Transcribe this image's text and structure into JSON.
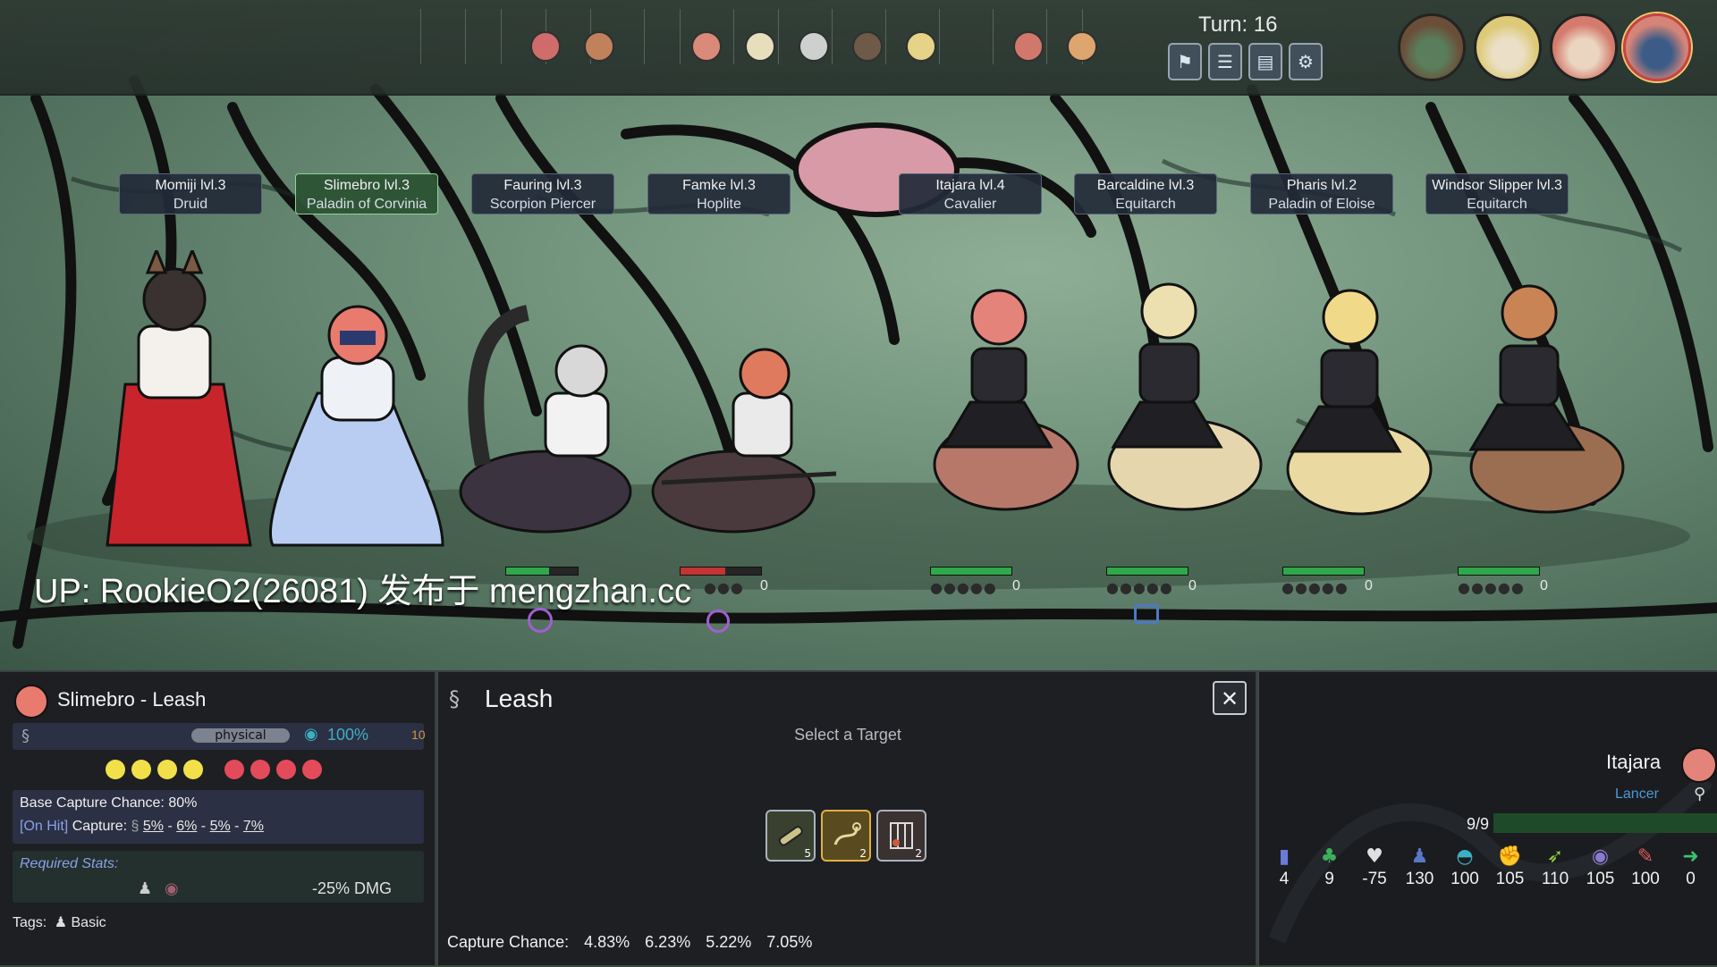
{
  "turn": "Turn: 16",
  "top_buttons": [
    {
      "icon": "flag-icon",
      "glyph": "⚑"
    },
    {
      "icon": "list-icon",
      "glyph": "☰"
    },
    {
      "icon": "book-icon",
      "glyph": "▤"
    },
    {
      "icon": "gear-icon",
      "glyph": "⚙"
    }
  ],
  "units": [
    {
      "name": "Momiji lvl.3",
      "cls": "Druid",
      "pips": ""
    },
    {
      "name": "Slimebro lvl.3",
      "cls": "Paladin of Corvinia",
      "pips": ""
    },
    {
      "name": "Fauring lvl.3",
      "cls": "Scorpion Piercer",
      "pips": ""
    },
    {
      "name": "Famke lvl.3",
      "cls": "Hoplite",
      "pips": "0"
    },
    {
      "name": "Itajara lvl.4",
      "cls": "Cavalier",
      "pips": "0"
    },
    {
      "name": "Barcaldine lvl.3",
      "cls": "Equitarch",
      "pips": "0"
    },
    {
      "name": "Pharis lvl.2",
      "cls": "Paladin of Eloise",
      "pips": "0"
    },
    {
      "name": "Windsor Slipper lvl.3",
      "cls": "Equitarch",
      "pips": "0"
    }
  ],
  "watermark": "UP: RookieO2(26081) 发布于 mengzhan.cc",
  "left_panel": {
    "title": "Slimebro - Leash",
    "damage_type": "physical",
    "accuracy": "100%",
    "crit": "10",
    "base_capture": "Base Capture Chance: 80%",
    "on_hit_tag": "[On Hit]",
    "capture_label": "Capture:",
    "capture_values": [
      "5%",
      "6%",
      "5%",
      "7%"
    ],
    "required_stats": "Required Stats:",
    "penalty": "-25% DMG",
    "tags_label": "Tags:",
    "tag": "Basic",
    "colors": {
      "yellow": "#f2e04a",
      "red": "#e44b5a"
    }
  },
  "mid_panel": {
    "skill_name": "Leash",
    "prompt": "Select a Target",
    "skills": [
      {
        "icon": "bandage-icon",
        "count": "5",
        "selected": false
      },
      {
        "icon": "leash-icon",
        "count": "2",
        "selected": true
      },
      {
        "icon": "cage-icon",
        "count": "2",
        "selected": false
      }
    ],
    "capture_label": "Capture Chance:",
    "capture_chances": [
      "4.83%",
      "6.23%",
      "5.22%",
      "7.05%"
    ]
  },
  "right_panel": {
    "name": "Itajara",
    "class": "Lancer",
    "hp": "9/9",
    "hp_fraction": 1.0,
    "stats": [
      {
        "icon": "level-icon",
        "value": "4",
        "color": "#6a7bd8"
      },
      {
        "icon": "clover-icon",
        "value": "9",
        "color": "#3fae5a"
      },
      {
        "icon": "heart-icon",
        "value": "-75",
        "color": "#e0e0e0"
      },
      {
        "icon": "figure-icon",
        "value": "130",
        "color": "#5a78c8"
      },
      {
        "icon": "helmet-icon",
        "value": "100",
        "color": "#3bb0c0"
      },
      {
        "icon": "fist-icon",
        "value": "105",
        "color": "#e0872e"
      },
      {
        "icon": "feather-icon",
        "value": "110",
        "color": "#8fcf3a"
      },
      {
        "icon": "eye-icon",
        "value": "105",
        "color": "#8a7bd0"
      },
      {
        "icon": "speech-icon",
        "value": "100",
        "color": "#e05a5a"
      },
      {
        "icon": "arrow-icon",
        "value": "0",
        "color": "#39c46a"
      }
    ]
  }
}
